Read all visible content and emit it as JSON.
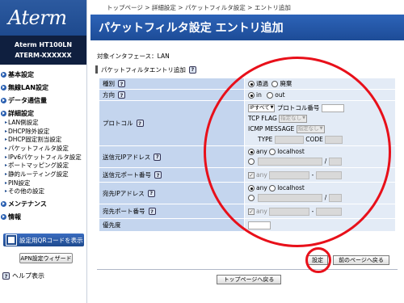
{
  "app": {
    "logo": "Aterm",
    "model_line1": "Aterm   HT100LN",
    "model_line2": "ATERM-XXXXXX"
  },
  "sidebar": {
    "sections": [
      {
        "label": "基本設定",
        "items": []
      },
      {
        "label": "無線LAN設定",
        "items": []
      },
      {
        "label": "データ通信量",
        "items": []
      },
      {
        "label": "詳細設定",
        "items": [
          "LAN側設定",
          "DHCP除外設定",
          "DHCP固定割当設定",
          "パケットフィルタ設定",
          "IPv6パケットフィルタ設定",
          "ポートマッピング設定",
          "静的ルーティング設定",
          "PIN設定",
          "その他の設定"
        ]
      },
      {
        "label": "メンテナンス",
        "items": []
      },
      {
        "label": "情報",
        "items": []
      }
    ],
    "qr_button": "設定用QRコードを表示",
    "apn_button": "APN設定ウィザード",
    "help_label": "ヘルプ表示",
    "help_icon": "?"
  },
  "breadcrumb": "トップページ > 詳細設定 > パケットフィルタ設定 > エントリ追加",
  "page_title": "パケットフィルタ設定 エントリ追加",
  "interface_line": "対象インタフェース：LAN",
  "section_title": "パケットフィルタエントリ追加",
  "form": {
    "kind": {
      "label": "種別",
      "opt1": "通過",
      "opt2": "廃棄"
    },
    "direction": {
      "label": "方向",
      "opt1": "in",
      "opt2": "out"
    },
    "protocol": {
      "label": "プロトコル",
      "select": "IPすべて",
      "number_label": "プロトコル番号",
      "tcp_flag_label": "TCP FLAG",
      "tcp_flag_value": "指定なし",
      "icmp_label": "ICMP MESSAGE",
      "icmp_value": "指定なし",
      "type_label": "TYPE",
      "code_label": "CODE"
    },
    "src_ip": {
      "label": "送信元IPアドレス",
      "opt_any": "any",
      "opt_local": "localhost",
      "slash": "/"
    },
    "src_port": {
      "label": "送信元ポート番号",
      "any": "any",
      "dash": "-"
    },
    "dst_ip": {
      "label": "宛先IPアドレス",
      "opt_any": "any",
      "opt_local": "localhost",
      "slash": "/"
    },
    "dst_port": {
      "label": "宛先ポート番号",
      "any": "any",
      "dash": "-"
    },
    "priority": {
      "label": "優先度"
    }
  },
  "buttons": {
    "set": "設定",
    "prev": "前のページへ戻る",
    "top": "トップページへ戻る"
  },
  "colors": {
    "title_bar": "#1d4c97",
    "label_cell": "#c4d5ee",
    "value_cell": "#e3ebf6",
    "annotation": "#e8101a"
  }
}
